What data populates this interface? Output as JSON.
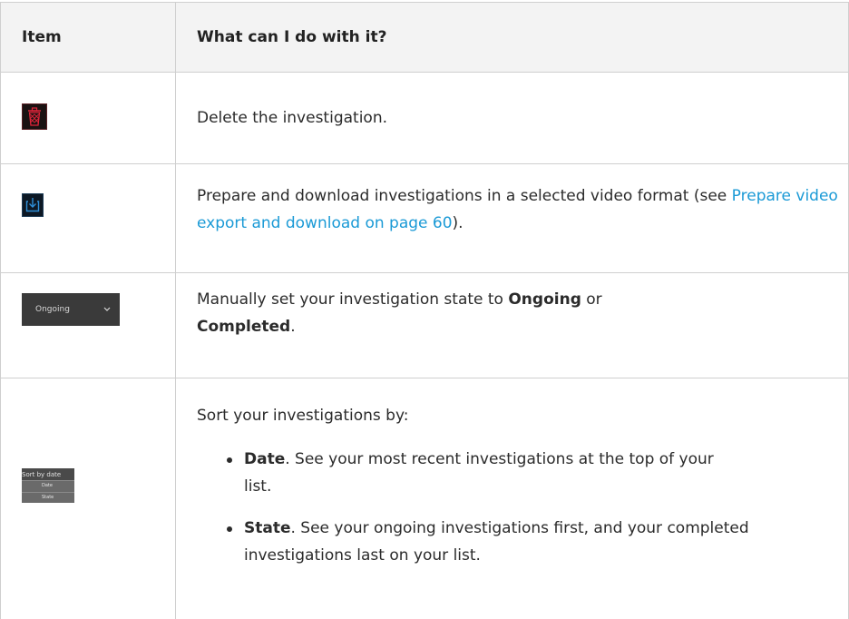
{
  "table": {
    "headers": {
      "item": "Item",
      "description": "What can I do with it?"
    },
    "rows": [
      {
        "icon": "trash-icon",
        "text": "Delete the investigation."
      },
      {
        "icon": "download-icon",
        "text_before": "Prepare and download investigations in a selected video format (see ",
        "link": "Prepare video export and download on page 60",
        "text_after": ")."
      },
      {
        "icon": "state-dropdown",
        "dropdown_label": "Ongoing",
        "text_before": "Manually set your investigation state to ",
        "bold1": "Ongoing",
        "text_mid": " or ",
        "bold2": "Completed",
        "text_after": "."
      },
      {
        "icon": "sort-dropdown",
        "sort_label": "Sort by date",
        "sort_option1": "Date",
        "sort_option2": "State",
        "intro": "Sort your investigations by:",
        "bullets": [
          {
            "bold": "Date",
            "text": ". See your most recent investigations at the top of your list."
          },
          {
            "bold": "State",
            "text": ". See your ongoing investigations first, and your completed investigations last on your list."
          }
        ]
      }
    ]
  },
  "colors": {
    "link": "#1b9ad6",
    "trash_red": "#e0243a",
    "download_blue": "#2f8fd8",
    "border": "#cfcfcf",
    "header_bg": "#f3f3f3"
  }
}
